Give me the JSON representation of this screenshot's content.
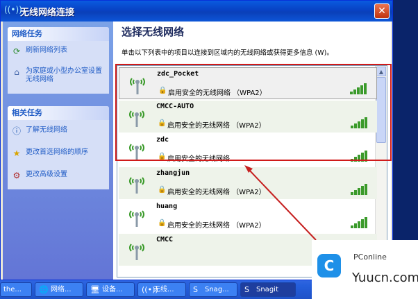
{
  "window": {
    "title": "无线网络连接",
    "title_icon": "((•))",
    "close": "✕"
  },
  "sidebar": {
    "network_tasks": {
      "header": "网络任务",
      "items": [
        {
          "label": "刷新网络列表",
          "icon": "refresh-icon"
        },
        {
          "label": "为家庭或小型办公室设置无线网络",
          "icon": "setup-icon"
        }
      ]
    },
    "related_tasks": {
      "header": "相关任务",
      "items": [
        {
          "label": "了解无线网络",
          "icon": "info-icon"
        },
        {
          "label": "更改首选网络的顺序",
          "icon": "star-icon"
        },
        {
          "label": "更改高级设置",
          "icon": "settings-icon"
        }
      ]
    }
  },
  "main": {
    "heading": "选择无线网络",
    "hint": "单击以下列表中的项目以连接到区域内的无线网络或获得更多信息 (W)。",
    "networks": [
      {
        "ssid": "zdc_Pocket",
        "security": "启用安全的无线网络 （WPA2）",
        "signal": 5
      },
      {
        "ssid": "CMCC-AUTO",
        "security": "启用安全的无线网络 （WPA2）",
        "signal": 5
      },
      {
        "ssid": "zdc",
        "security": "启用安全的无线网络",
        "signal": 5
      },
      {
        "ssid": "zhangjun",
        "security": "启用安全的无线网络 （WPA2）",
        "signal": 5
      },
      {
        "ssid": "huang",
        "security": "启用安全的无线网络 （WPA2）",
        "signal": 5
      },
      {
        "ssid": "CMCC",
        "security": "",
        "signal": 0
      }
    ]
  },
  "taskbar": [
    {
      "label": "the...",
      "icon": ""
    },
    {
      "label": "网络...",
      "icon": "🌐"
    },
    {
      "label": "设备...",
      "icon": "🖥"
    },
    {
      "label": "无线...",
      "icon": "((•))"
    },
    {
      "label": "Snag...",
      "icon": "S"
    },
    {
      "label": "Snagit",
      "icon": "S"
    }
  ],
  "watermark": {
    "brand": "PConline",
    "site": "Yuucn.com"
  },
  "colors": {
    "highlight": "#d01a1a",
    "link": "#215dc6",
    "signal": "#3a9a2a"
  }
}
